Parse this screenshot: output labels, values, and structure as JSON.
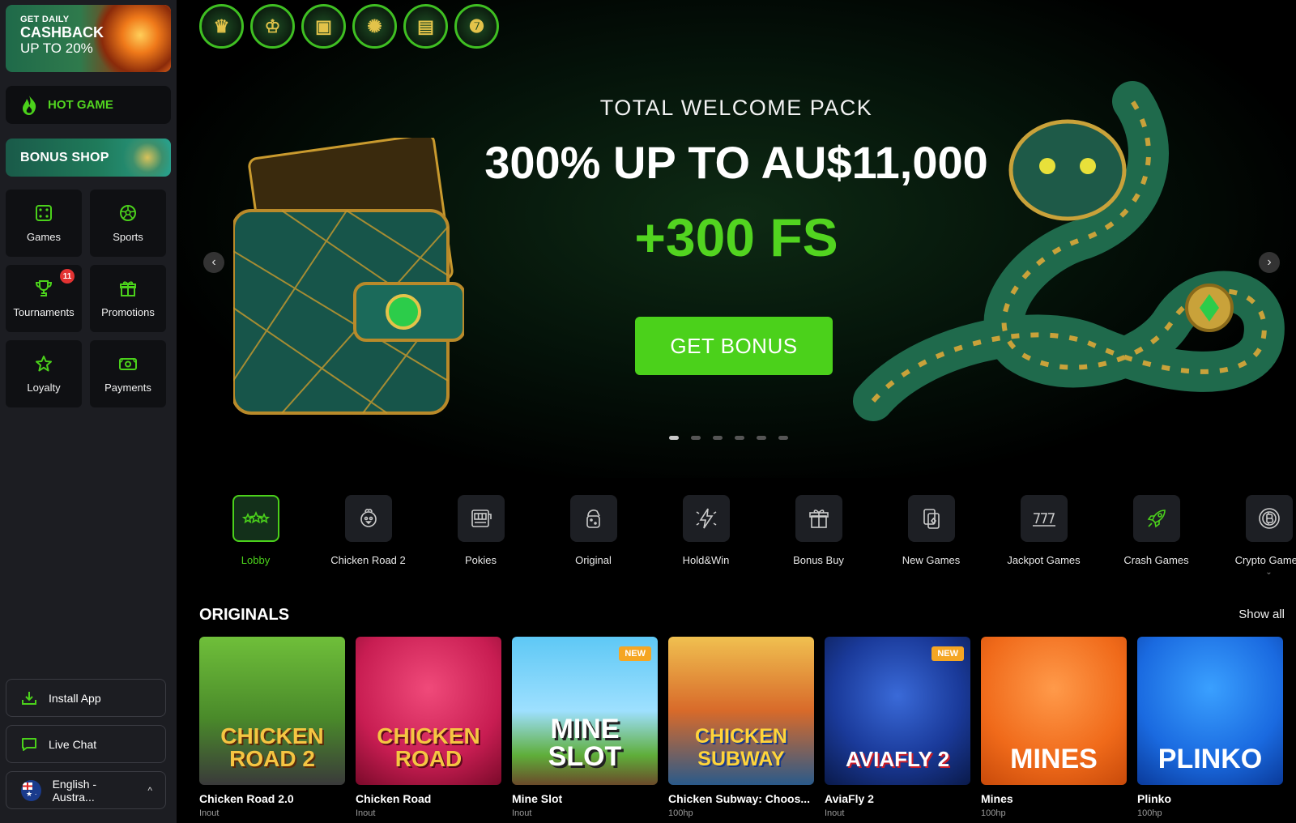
{
  "sidebar": {
    "cashback": {
      "small": "GET DAILY",
      "big": "CASHBACK",
      "mid": "UP TO 20%"
    },
    "hot_game": "HOT GAME",
    "bonus_shop": "BONUS SHOP",
    "tiles": [
      {
        "label": "Games",
        "icon": "dice-icon"
      },
      {
        "label": "Sports",
        "icon": "soccer-ball-icon"
      },
      {
        "label": "Tournaments",
        "icon": "trophy-icon",
        "badge": "11"
      },
      {
        "label": "Promotions",
        "icon": "gift-icon"
      },
      {
        "label": "Loyalty",
        "icon": "star-icon"
      },
      {
        "label": "Payments",
        "icon": "cash-icon"
      }
    ],
    "install_app": "Install App",
    "live_chat": "Live Chat",
    "language": "English - Austra..."
  },
  "hero": {
    "subtitle": "TOTAL WELCOME PACK",
    "title": "300% UP TO AU$11,000",
    "free_spins": "+300 FS",
    "button": "GET BONUS",
    "slide_count": 6,
    "active_slide": 1
  },
  "categories": [
    {
      "label": "Lobby",
      "icon": "stars-icon",
      "active": true
    },
    {
      "label": "Chicken Road 2",
      "icon": "chicken-icon"
    },
    {
      "label": "Pokies",
      "icon": "slot-machine-icon"
    },
    {
      "label": "Original",
      "icon": "dice-cup-icon"
    },
    {
      "label": "Hold&Win",
      "icon": "lightning-icon"
    },
    {
      "label": "Bonus Buy",
      "icon": "gift-box-icon"
    },
    {
      "label": "New Games",
      "icon": "cards-icon"
    },
    {
      "label": "Jackpot Games",
      "icon": "777-icon"
    },
    {
      "label": "Crash Games",
      "icon": "rocket-icon"
    },
    {
      "label": "Crypto Games",
      "icon": "bitcoin-icon"
    }
  ],
  "originals": {
    "title": "ORIGINALS",
    "show_all": "Show all",
    "games": [
      {
        "name": "Chicken Road 2.0",
        "provider": "Inout",
        "art": "CHICKEN ROAD 2",
        "new": false
      },
      {
        "name": "Chicken Road",
        "provider": "Inout",
        "art": "CHICKEN ROAD",
        "new": false
      },
      {
        "name": "Mine Slot",
        "provider": "Inout",
        "art": "MINE SLOT",
        "new": true
      },
      {
        "name": "Chicken Subway: Choos...",
        "provider": "100hp",
        "art": "CHICKEN SUBWAY",
        "new": false
      },
      {
        "name": "AviaFly 2",
        "provider": "Inout",
        "art": "AVIAFLY 2",
        "new": true
      },
      {
        "name": "Mines",
        "provider": "100hp",
        "art": "MINES",
        "new": false
      },
      {
        "name": "Plinko",
        "provider": "100hp",
        "art": "PLINKO",
        "new": false
      }
    ],
    "new_label": "NEW"
  },
  "colors": {
    "accent": "#4bd11b",
    "sidebar_bg": "#1c1d22",
    "tile_bg": "#0f1013"
  }
}
